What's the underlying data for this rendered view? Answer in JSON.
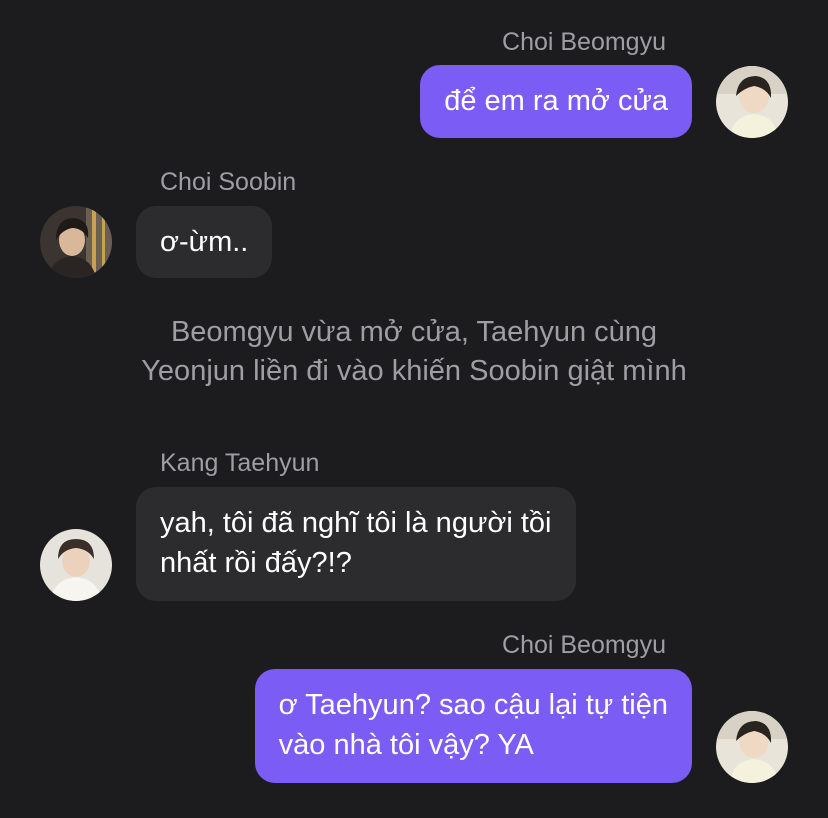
{
  "messages": [
    {
      "sender": "Choi Beomgyu",
      "direction": "outgoing",
      "lines": [
        "để em ra mở cửa"
      ],
      "avatar": "avatar-beomgyu"
    },
    {
      "sender": "Choi Soobin",
      "direction": "incoming",
      "lines": [
        "ơ-ừm.."
      ],
      "avatar": "avatar-soobin"
    },
    {
      "narration": [
        "Beomgyu vừa mở cửa, Taehyun cùng",
        "Yeonjun liền đi vào khiến Soobin giật mình"
      ]
    },
    {
      "sender": "Kang Taehyun",
      "direction": "incoming",
      "lines": [
        "yah, tôi đã nghĩ tôi là người tồi",
        "nhất rồi đấy?!?"
      ],
      "avatar": "avatar-taehyun"
    },
    {
      "sender": "Choi Beomgyu",
      "direction": "outgoing",
      "lines": [
        "ơ Taehyun? sao cậu lại tự tiện",
        "vào nhà tôi vậy? YA"
      ],
      "avatar": "avatar-beomgyu"
    }
  ],
  "colors": {
    "background": "#1c1c1e",
    "outgoing_bubble": "#7b5cf5",
    "incoming_bubble": "#2c2c2e",
    "secondary_text": "#9e9ea3"
  }
}
